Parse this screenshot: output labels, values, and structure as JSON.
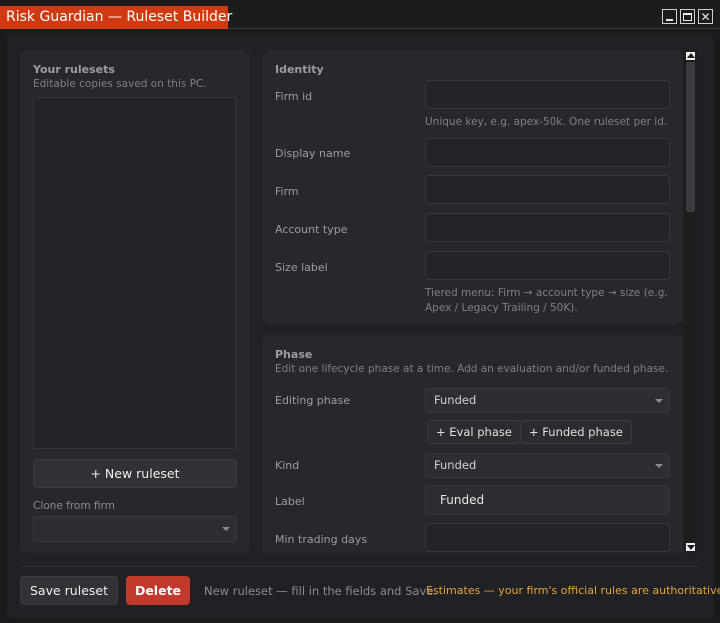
{
  "window": {
    "title": "Risk Guardian — Ruleset Builder"
  },
  "left": {
    "title": "Your rulesets",
    "subtitle": "Editable copies saved on this PC.",
    "new_button": "+ New ruleset",
    "clone_label": "Clone from firm",
    "clone_value": ""
  },
  "identity": {
    "title": "Identity",
    "firm_id_label": "Firm id",
    "firm_id_hint": "Unique key, e.g. apex-50k. One ruleset per id.",
    "display_name_label": "Display name",
    "firm_label": "Firm",
    "account_type_label": "Account type",
    "size_label_label": "Size label",
    "size_hint": "Tiered menu: Firm → account type → size (e.g. Apex / Legacy Trailing / 50K)."
  },
  "phase": {
    "title": "Phase",
    "subtitle": "Edit one lifecycle phase at a time. Add an evaluation and/or funded phase.",
    "editing_phase_label": "Editing phase",
    "editing_phase_value": "Funded",
    "add_eval_button": "+ Eval phase",
    "add_funded_button": "+ Funded phase",
    "kind_label": "Kind",
    "kind_value": "Funded",
    "label_label": "Label",
    "label_value": "Funded",
    "min_days_label": "Min trading days"
  },
  "footer": {
    "save_button": "Save ruleset",
    "delete_button": "Delete",
    "status": "New ruleset — fill in the fields and Save.",
    "warning": "Estimates — your firm's official rules are authoritative."
  },
  "colors": {
    "accent": "#d13a10",
    "danger": "#c0392b",
    "warning": "#e6a23c",
    "background": "#1a1b1d"
  }
}
